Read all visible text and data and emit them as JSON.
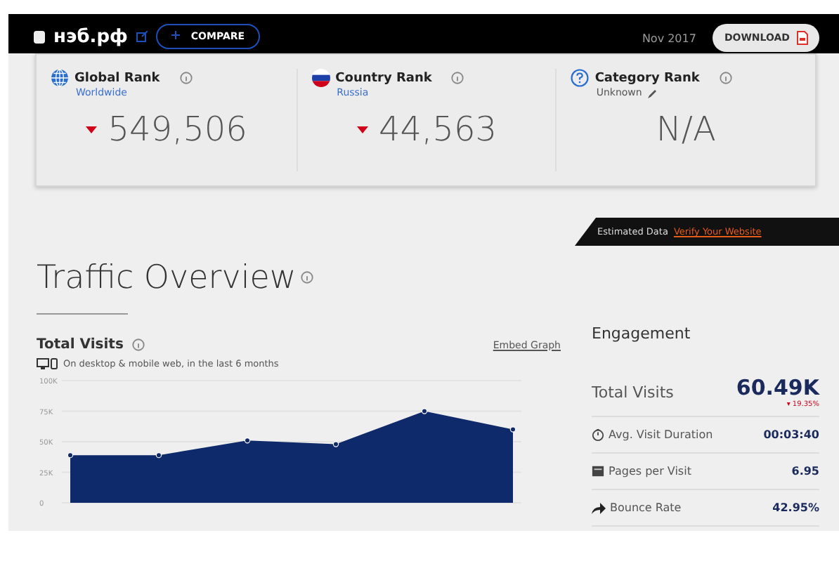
{
  "header": {
    "site": "нэб.рф",
    "compare": "COMPARE",
    "date": "Nov 2017",
    "download": "DOWNLOAD"
  },
  "ranks": [
    {
      "kind": "globe",
      "title": "Global Rank",
      "subtitle": "Worldwide",
      "subtitle_link": true,
      "value": "549,506",
      "down": true,
      "editable": false
    },
    {
      "kind": "flag",
      "title": "Country Rank",
      "subtitle": "Russia",
      "subtitle_link": true,
      "value": "44,563",
      "down": true,
      "editable": false
    },
    {
      "kind": "question",
      "title": "Category Rank",
      "subtitle": "Unknown",
      "subtitle_link": false,
      "value": "N/A",
      "down": false,
      "editable": true
    }
  ],
  "traffic": {
    "title": "Traffic Overview",
    "banner": {
      "text": "Estimated Data",
      "link": "Verify Your Website"
    },
    "visits": {
      "title": "Total Visits",
      "embed": "Embed Graph",
      "note": "On desktop & mobile web, in the last 6 months",
      "chart_data": {
        "type": "area",
        "grid": true,
        "ylim": [
          0,
          100000
        ],
        "yticks": [
          {
            "value": 0,
            "label": "0"
          },
          {
            "value": 25000,
            "label": "25K"
          },
          {
            "value": 50000,
            "label": "50K"
          },
          {
            "value": 75000,
            "label": "75K"
          },
          {
            "value": 100000,
            "label": "100K"
          }
        ],
        "values": [
          39000,
          39000,
          51000,
          48000,
          75000,
          60000
        ]
      }
    },
    "engagement": {
      "title": "Engagement",
      "total_label": "Total Visits",
      "total_value": "60.49K",
      "total_change": "▾ 19.35%",
      "rows": [
        {
          "kind": "clock",
          "label": "Avg. Visit Duration",
          "value": "00:03:40"
        },
        {
          "kind": "pages",
          "label": "Pages per Visit",
          "value": "6.95"
        },
        {
          "kind": "bounce",
          "label": "Bounce Rate",
          "value": "42.95%"
        }
      ]
    }
  }
}
